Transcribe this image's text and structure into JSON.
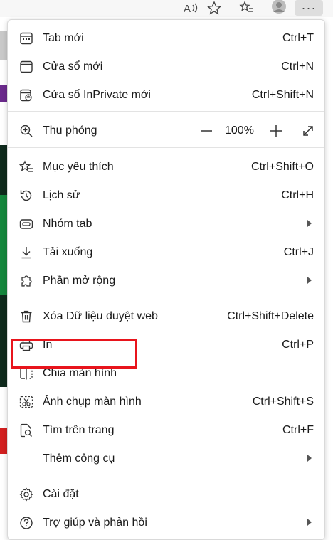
{
  "toolbar": {
    "read_aloud_icon": "read-aloud-icon",
    "favorite_icon": "star-icon",
    "favorites_icon": "favorites-list-icon",
    "profile_icon": "avatar",
    "more_icon": "ellipsis-icon",
    "more_glyph": "···"
  },
  "menu": {
    "new_tab": {
      "label": "Tab mới",
      "shortcut": "Ctrl+T"
    },
    "new_window": {
      "label": "Cửa sổ mới",
      "shortcut": "Ctrl+N"
    },
    "new_inprivate": {
      "label": "Cửa sổ InPrivate mới",
      "shortcut": "Ctrl+Shift+N"
    },
    "zoom": {
      "label": "Thu phóng",
      "value": "100%"
    },
    "favorites": {
      "label": "Mục yêu thích",
      "shortcut": "Ctrl+Shift+O"
    },
    "history": {
      "label": "Lịch sử",
      "shortcut": "Ctrl+H"
    },
    "tab_groups": {
      "label": "Nhóm tab"
    },
    "downloads": {
      "label": "Tải xuống",
      "shortcut": "Ctrl+J"
    },
    "extensions": {
      "label": "Phần mở rộng"
    },
    "clear_data": {
      "label": "Xóa Dữ liệu duyệt web",
      "shortcut": "Ctrl+Shift+Delete"
    },
    "print": {
      "label": "In",
      "shortcut": "Ctrl+P"
    },
    "split_screen": {
      "label": "Chia màn hình"
    },
    "screenshot": {
      "label": "Ảnh chụp màn hình",
      "shortcut": "Ctrl+Shift+S"
    },
    "find": {
      "label": "Tìm trên trang",
      "shortcut": "Ctrl+F"
    },
    "more_tools": {
      "label": "Thêm công cụ"
    },
    "settings": {
      "label": "Cài đặt"
    },
    "help": {
      "label": "Trợ giúp và phản hồi"
    }
  },
  "colors": {
    "highlight": "#e8141c",
    "separator": "#e3e3e3",
    "menu_background": "#ffffff",
    "text": "#1a1a1a"
  }
}
